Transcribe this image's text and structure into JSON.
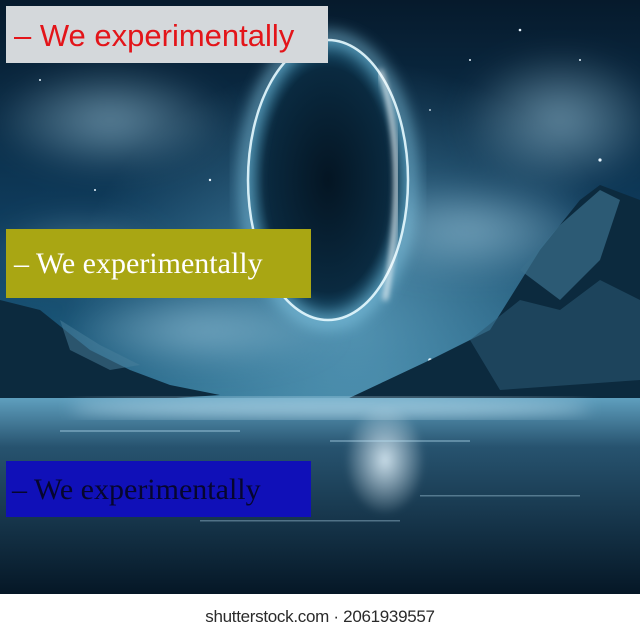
{
  "banners": {
    "top": "– We experimentally",
    "middle": "– We experimentally",
    "bottom": "– We experimentally"
  },
  "footer": {
    "watermark": "shutterstock.com · 2061939557"
  },
  "colors": {
    "top_banner_bg": "#d4d8db",
    "top_banner_text": "#e3151a",
    "middle_banner_bg": "#a9a613",
    "middle_banner_text": "#ffffff",
    "bottom_banner_bg": "#1010b8",
    "bottom_banner_text": "#06062e"
  }
}
